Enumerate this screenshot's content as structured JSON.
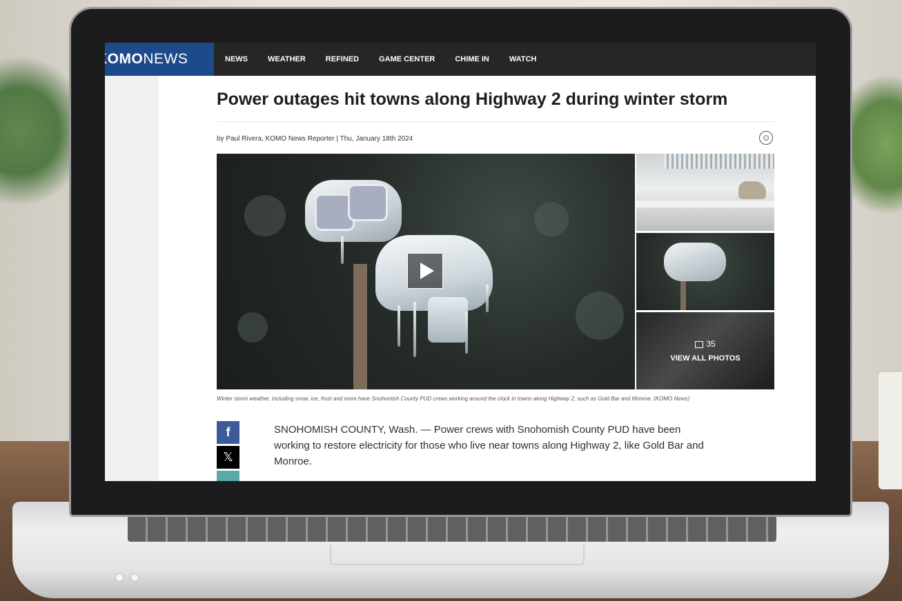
{
  "site": {
    "logo_bold": "OMO",
    "logo_thin": "NEWS",
    "logo_prefix": "K"
  },
  "nav": {
    "items": [
      {
        "label": "NEWS"
      },
      {
        "label": "WEATHER"
      },
      {
        "label": "REFINED"
      },
      {
        "label": "GAME CENTER"
      },
      {
        "label": "CHIME IN"
      },
      {
        "label": "WATCH"
      }
    ]
  },
  "article": {
    "headline": "Power outages hit towns along Highway 2 during winter storm",
    "byline": "by Paul Rivera, KOMO News Reporter | Thu, January 18th 2024",
    "caption": "Winter storm weather, including snow, ice, frost and more have Snohomish County PUD crews working around the clock in towns along Highway 2, such as Gold Bar and Monroe. (KOMO News)",
    "body_first_paragraph": "SNOHOMISH COUNTY, Wash. — Power crews with Snohomish County PUD have been working to restore electricity for those who live near towns along Highway 2, like Gold Bar and Monroe."
  },
  "gallery": {
    "photo_count": "35",
    "view_all_label": "VIEW ALL PHOTOS"
  },
  "share": {
    "facebook_icon": "f",
    "x_icon": "𝕏"
  },
  "colors": {
    "nav_bg": "#262626",
    "logo_bg": "#1c4a8a",
    "facebook": "#3b5a9a"
  }
}
